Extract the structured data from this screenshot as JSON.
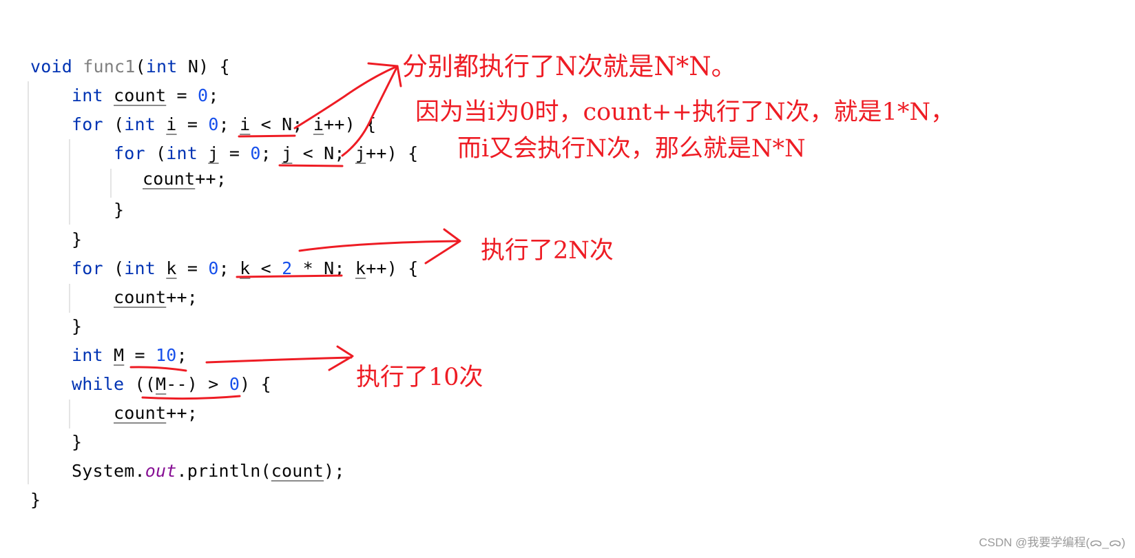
{
  "code": {
    "lines": [
      {
        "parts": [
          [
            "kw",
            "void "
          ],
          [
            "fn",
            "func1"
          ],
          [
            "",
            "("
          ],
          [
            "kw",
            "int"
          ],
          [
            "",
            " N) {"
          ]
        ]
      },
      {
        "parts": [
          [
            "kw",
            "int "
          ],
          [
            "u",
            "count"
          ],
          [
            "",
            " = "
          ],
          [
            "num",
            "0"
          ],
          [
            "",
            ";"
          ]
        ]
      },
      {
        "parts": [
          [
            "kw",
            "for "
          ],
          [
            "",
            "("
          ],
          [
            "kw",
            "int "
          ],
          [
            "u",
            "i"
          ],
          [
            "",
            " = "
          ],
          [
            "num",
            "0"
          ],
          [
            "",
            "; "
          ],
          [
            "u",
            "i"
          ],
          [
            "",
            " < N; "
          ],
          [
            "u",
            "i"
          ],
          [
            "",
            "++) {"
          ]
        ]
      },
      {
        "parts": [
          [
            "kw",
            "for "
          ],
          [
            "",
            "("
          ],
          [
            "kw",
            "int "
          ],
          [
            "u",
            "j"
          ],
          [
            "",
            " = "
          ],
          [
            "num",
            "0"
          ],
          [
            "",
            "; "
          ],
          [
            "u",
            "j"
          ],
          [
            "",
            " < N; "
          ],
          [
            "u",
            "j"
          ],
          [
            "",
            "++) {"
          ]
        ]
      },
      {
        "parts": [
          [
            "u",
            "count"
          ],
          [
            "",
            "++;"
          ]
        ]
      },
      {
        "parts": [
          [
            "",
            "}"
          ]
        ]
      },
      {
        "parts": [
          [
            "",
            "}"
          ]
        ]
      },
      {
        "parts": [
          [
            "kw",
            "for "
          ],
          [
            "",
            "("
          ],
          [
            "kw",
            "int "
          ],
          [
            "u",
            "k"
          ],
          [
            "",
            " = "
          ],
          [
            "num",
            "0"
          ],
          [
            "",
            "; "
          ],
          [
            "u",
            "k"
          ],
          [
            "",
            " < "
          ],
          [
            "num",
            "2"
          ],
          [
            "",
            " * N; "
          ],
          [
            "u",
            "k"
          ],
          [
            "",
            "++) {"
          ]
        ]
      },
      {
        "parts": [
          [
            "u",
            "count"
          ],
          [
            "",
            "++;"
          ]
        ]
      },
      {
        "parts": [
          [
            "",
            "}"
          ]
        ]
      },
      {
        "parts": [
          [
            "kw",
            "int "
          ],
          [
            "u",
            "M"
          ],
          [
            "",
            " = "
          ],
          [
            "num",
            "10"
          ],
          [
            "",
            ";"
          ]
        ]
      },
      {
        "parts": [
          [
            "kw",
            "while "
          ],
          [
            "",
            "(("
          ],
          [
            "u",
            "M"
          ],
          [
            "",
            "--) > "
          ],
          [
            "num",
            "0"
          ],
          [
            "",
            ") {"
          ]
        ]
      },
      {
        "parts": [
          [
            "u",
            "count"
          ],
          [
            "",
            "++;"
          ]
        ]
      },
      {
        "parts": [
          [
            "",
            "}"
          ]
        ]
      },
      {
        "parts": [
          [
            "",
            "System."
          ],
          [
            "fld",
            "out"
          ],
          [
            "",
            ".println("
          ],
          [
            "u",
            "count"
          ],
          [
            "",
            ");"
          ]
        ]
      },
      {
        "parts": [
          [
            "",
            "}"
          ]
        ]
      }
    ]
  },
  "annotations": {
    "nested_loops_title": "分别都执行了N次就是N*N。",
    "nested_loops_line1": "因为当i为0时，count++执行了N次，就是1*N，",
    "nested_loops_line2": "而i又会执行N次，那么就是N*N",
    "loop_2n": "执行了2N次",
    "loop_10": "执行了10次"
  },
  "watermark": "CSDN @我要学编程(ᯅ_ᯅ)",
  "colors": {
    "keyword": "#0033b3",
    "number": "#1750eb",
    "annotation": "#ee1c24",
    "static_field": "#871094"
  }
}
